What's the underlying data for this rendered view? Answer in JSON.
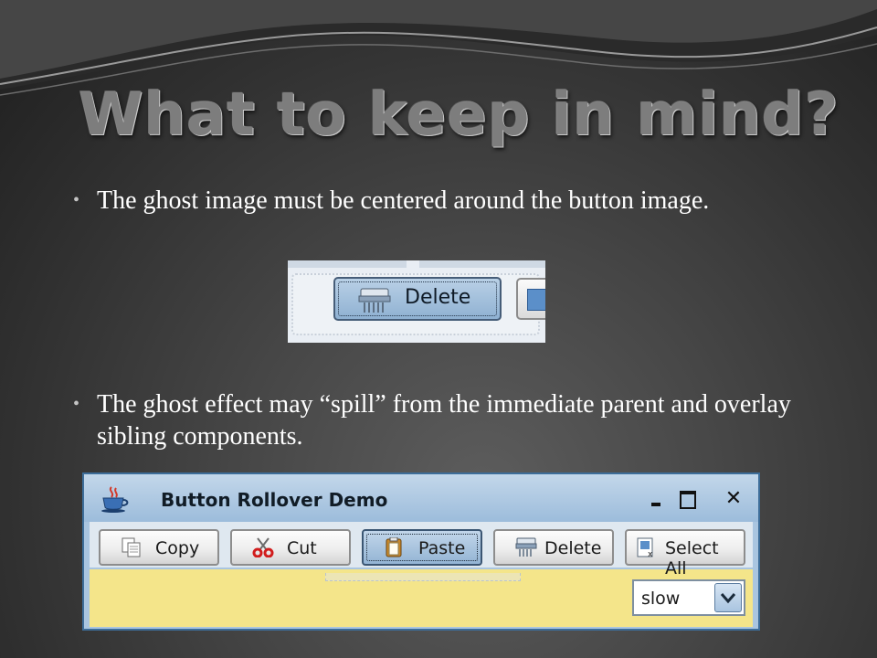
{
  "slide": {
    "title": "What to keep in mind?",
    "bullets": [
      "The ghost image must be centered around the button image.",
      "The ghost effect may “spill” from the immediate parent and overlay sibling components."
    ],
    "bullet_glyph": "•"
  },
  "crop_image": {
    "button_label": "Delete",
    "button_icon": "shredder-icon"
  },
  "demo_window": {
    "title": "Button Rollover Demo",
    "title_icon": "java-cup-icon",
    "controls": {
      "minimize": "minimize-icon",
      "maximize": "maximize-icon",
      "close": "✕"
    },
    "buttons": [
      {
        "label": "Copy",
        "icon": "copy-icon"
      },
      {
        "label": "Cut",
        "icon": "scissors-icon"
      },
      {
        "label": "Paste",
        "icon": "clipboard-icon"
      },
      {
        "label": "Delete",
        "icon": "shredder-icon"
      },
      {
        "label": "Select All",
        "icon": "select-all-icon"
      }
    ],
    "speed_combo": {
      "value": "slow",
      "arrow_icon": "chevron-down-icon"
    },
    "colors": {
      "panel": "#f4e58a",
      "rollover": "#a9c5e0",
      "border": "#3d6d99"
    }
  }
}
